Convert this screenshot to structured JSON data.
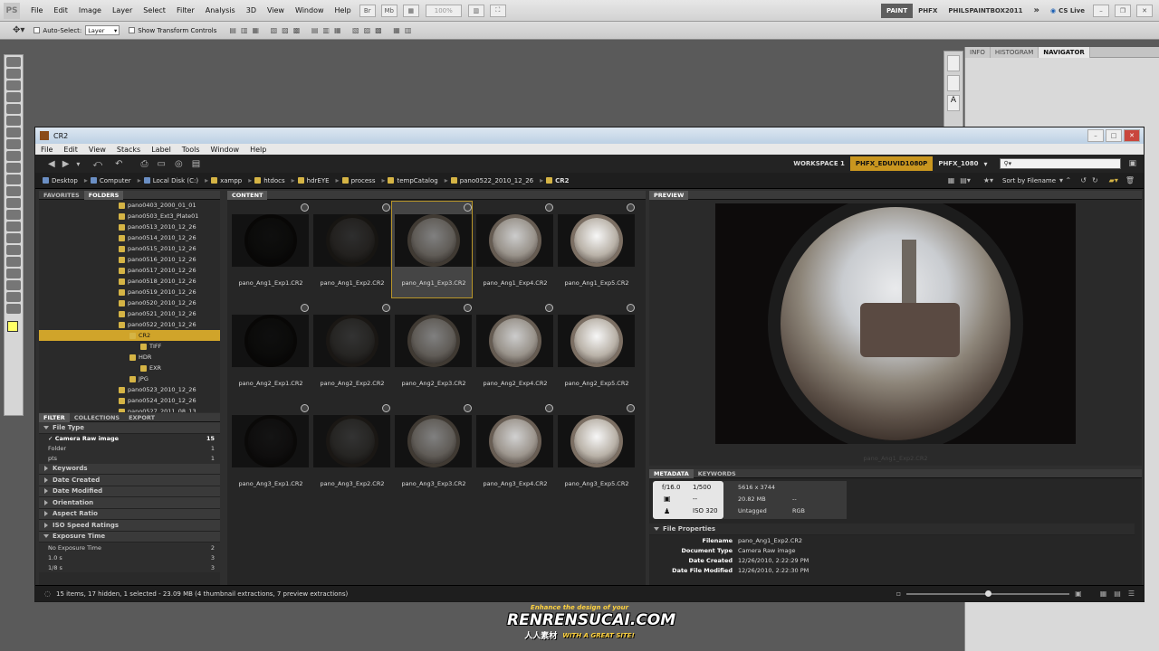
{
  "photoshop": {
    "logo": "PS",
    "menu": [
      "File",
      "Edit",
      "Image",
      "Layer",
      "Select",
      "Filter",
      "Analysis",
      "3D",
      "View",
      "Window",
      "Help"
    ],
    "zoom": "100%",
    "workspaces": [
      "PAINT",
      "PHFX",
      "PHILSPAINTBOX2011"
    ],
    "cs_live": "CS Live",
    "options": {
      "auto_select_label": "Auto-Select:",
      "auto_select_value": "Layer",
      "show_transform_label": "Show Transform Controls"
    },
    "panel_tabs": [
      "INFO",
      "HISTOGRAM",
      "NAVIGATOR"
    ]
  },
  "bridge": {
    "title": "CR2",
    "menu": [
      "File",
      "Edit",
      "View",
      "Stacks",
      "Label",
      "Tools",
      "Window",
      "Help"
    ],
    "workspaces": [
      "WORKSPACE 1",
      "PHFX_EDUVID1080P",
      "PHFX_1080"
    ],
    "search_placeholder": "",
    "path": [
      "Desktop",
      "Computer",
      "Local Disk (C:)",
      "xampp",
      "htdocs",
      "hdrEYE",
      "process",
      "tempCatalog",
      "pano0522_2010_12_26",
      "CR2"
    ],
    "sort_label": "Sort by Filename",
    "left_tabs": [
      "FAVORITES",
      "FOLDERS"
    ],
    "folders": [
      {
        "name": "pano0403_2000_01_01",
        "indent": 0
      },
      {
        "name": "pano0503_Ext3_Plate01",
        "indent": 0
      },
      {
        "name": "pano0513_2010_12_26",
        "indent": 0
      },
      {
        "name": "pano0514_2010_12_26",
        "indent": 0
      },
      {
        "name": "pano0515_2010_12_26",
        "indent": 0
      },
      {
        "name": "pano0516_2010_12_26",
        "indent": 0
      },
      {
        "name": "pano0517_2010_12_26",
        "indent": 0
      },
      {
        "name": "pano0518_2010_12_26",
        "indent": 0
      },
      {
        "name": "pano0519_2010_12_26",
        "indent": 0
      },
      {
        "name": "pano0520_2010_12_26",
        "indent": 0
      },
      {
        "name": "pano0521_2010_12_26",
        "indent": 0
      },
      {
        "name": "pano0522_2010_12_26",
        "indent": 0
      },
      {
        "name": "CR2",
        "indent": 1,
        "selected": true
      },
      {
        "name": "TIFF",
        "indent": 2
      },
      {
        "name": "HDR",
        "indent": 1
      },
      {
        "name": "EXR",
        "indent": 2
      },
      {
        "name": "JPG",
        "indent": 1
      },
      {
        "name": "pano0523_2010_12_26",
        "indent": 0
      },
      {
        "name": "pano0524_2010_12_26",
        "indent": 0
      },
      {
        "name": "pano0527_2011_08_13",
        "indent": 0
      }
    ],
    "filter_tabs": [
      "FILTER",
      "COLLECTIONS",
      "EXPORT"
    ],
    "filter": {
      "file_type": "File Type",
      "file_type_items": [
        {
          "label": "Camera Raw image",
          "count": "15",
          "checked": true
        },
        {
          "label": "Folder",
          "count": "1"
        },
        {
          "label": "pts",
          "count": "1"
        }
      ],
      "sections": [
        "Keywords",
        "Date Created",
        "Date Modified",
        "Orientation",
        "Aspect Ratio",
        "ISO Speed Ratings"
      ],
      "exposure": "Exposure Time",
      "exposure_items": [
        {
          "label": "No Exposure Time",
          "count": "2"
        },
        {
          "label": "1.0 s",
          "count": "3"
        },
        {
          "label": "1/8 s",
          "count": "3"
        }
      ]
    },
    "content_tab": "CONTENT",
    "thumbnails": [
      {
        "name": "pano_Ang1_Exp1.CR2",
        "brightness": 0.06
      },
      {
        "name": "pano_Ang1_Exp2.CR2",
        "brightness": 0.18
      },
      {
        "name": "pano_Ang1_Exp3.CR2",
        "brightness": 0.5,
        "selected": true
      },
      {
        "name": "pano_Ang1_Exp4.CR2",
        "brightness": 0.8
      },
      {
        "name": "pano_Ang1_Exp5.CR2",
        "brightness": 0.97
      },
      {
        "name": "pano_Ang2_Exp1.CR2",
        "brightness": 0.06
      },
      {
        "name": "pano_Ang2_Exp2.CR2",
        "brightness": 0.2
      },
      {
        "name": "pano_Ang2_Exp3.CR2",
        "brightness": 0.5
      },
      {
        "name": "pano_Ang2_Exp4.CR2",
        "brightness": 0.8
      },
      {
        "name": "pano_Ang2_Exp5.CR2",
        "brightness": 0.97
      },
      {
        "name": "pano_Ang3_Exp1.CR2",
        "brightness": 0.08
      },
      {
        "name": "pano_Ang3_Exp2.CR2",
        "brightness": 0.2
      },
      {
        "name": "pano_Ang3_Exp3.CR2",
        "brightness": 0.5
      },
      {
        "name": "pano_Ang3_Exp4.CR2",
        "brightness": 0.82
      },
      {
        "name": "pano_Ang3_Exp5.CR2",
        "brightness": 0.97
      }
    ],
    "preview_tab": "PREVIEW",
    "preview_caption": "pano_Ang1_Exp2.CR2",
    "meta_tabs": [
      "METADATA",
      "KEYWORDS"
    ],
    "meta_card": {
      "aperture": "f/16.0",
      "shutter": "1/500",
      "ev": "--",
      "iso": "ISO 320",
      "dims": "5616 x 3744",
      "size": "20.82 MB",
      "size2": "--",
      "tag": "Untagged",
      "colorspace": "RGB"
    },
    "file_properties_title": "File Properties",
    "file_properties": [
      {
        "label": "Filename",
        "value": "pano_Ang1_Exp2.CR2"
      },
      {
        "label": "Document Type",
        "value": "Camera Raw image"
      },
      {
        "label": "Date Created",
        "value": "12/26/2010, 2:22:29 PM"
      },
      {
        "label": "Date File Modified",
        "value": "12/26/2010, 2:22:30 PM"
      }
    ],
    "status": "15 items, 17 hidden, 1 selected - 23.09 MB (4 thumbnail extractions, 7 preview extractions)",
    "thumbnail_size": 0.5
  },
  "watermark": {
    "tagline": "Enhance the design of your",
    "brand": "RENRENSUCAI.COM",
    "cn": "人人素材",
    "slogan": "WITH A GREAT SITE!"
  }
}
